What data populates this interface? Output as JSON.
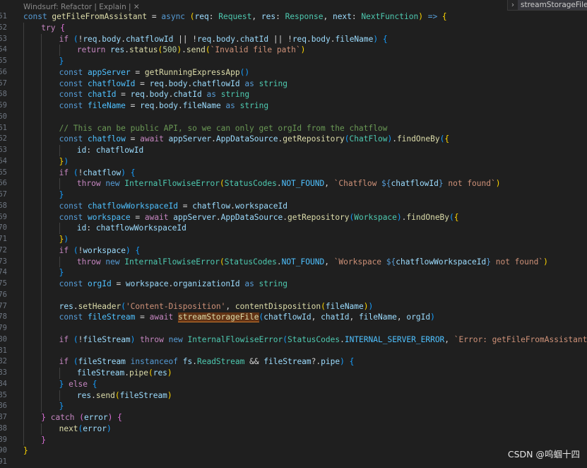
{
  "codelens": "Windsurf: Refactor | Explain | ✕",
  "sticky_scroll": {
    "chevron": "›",
    "label": "streamStorageFile"
  },
  "watermark": "CSDN @呜蝈十四",
  "code_lines": [
    {
      "n": "51",
      "ind": 0,
      "tokens": [
        [
          "k",
          "const "
        ],
        [
          "f",
          "getFileFromAssistant"
        ],
        [
          "p",
          " = "
        ],
        [
          "k",
          "async "
        ],
        [
          "b1",
          "("
        ],
        [
          "v",
          "req"
        ],
        [
          "p",
          ": "
        ],
        [
          "t",
          "Request"
        ],
        [
          "p",
          ", "
        ],
        [
          "v",
          "res"
        ],
        [
          "p",
          ": "
        ],
        [
          "t",
          "Response"
        ],
        [
          "p",
          ", "
        ],
        [
          "v",
          "next"
        ],
        [
          "p",
          ": "
        ],
        [
          "t",
          "NextFunction"
        ],
        [
          "b1",
          ")"
        ],
        [
          "k",
          " => "
        ],
        [
          "b1",
          "{"
        ]
      ]
    },
    {
      "n": "52",
      "ind": 1,
      "tokens": [
        [
          "kc",
          "try "
        ],
        [
          "b2",
          "{"
        ]
      ]
    },
    {
      "n": "53",
      "ind": 2,
      "tokens": [
        [
          "kc",
          "if "
        ],
        [
          "b3",
          "("
        ],
        [
          "p",
          "!"
        ],
        [
          "v",
          "req"
        ],
        [
          "p",
          "."
        ],
        [
          "v",
          "body"
        ],
        [
          "p",
          "."
        ],
        [
          "v",
          "chatflowId"
        ],
        [
          "p",
          " || !"
        ],
        [
          "v",
          "req"
        ],
        [
          "p",
          "."
        ],
        [
          "v",
          "body"
        ],
        [
          "p",
          "."
        ],
        [
          "v",
          "chatId"
        ],
        [
          "p",
          " || !"
        ],
        [
          "v",
          "req"
        ],
        [
          "p",
          "."
        ],
        [
          "v",
          "body"
        ],
        [
          "p",
          "."
        ],
        [
          "v",
          "fileName"
        ],
        [
          "b3",
          ")"
        ],
        [
          "p",
          " "
        ],
        [
          "b3",
          "{"
        ]
      ]
    },
    {
      "n": "54",
      "ind": 3,
      "tokens": [
        [
          "kc",
          "return "
        ],
        [
          "v",
          "res"
        ],
        [
          "p",
          "."
        ],
        [
          "f",
          "status"
        ],
        [
          "b1",
          "("
        ],
        [
          "n",
          "500"
        ],
        [
          "b1",
          ")"
        ],
        [
          "p",
          "."
        ],
        [
          "f",
          "send"
        ],
        [
          "b1",
          "("
        ],
        [
          "s",
          "`Invalid file path`"
        ],
        [
          "b1",
          ")"
        ]
      ]
    },
    {
      "n": "55",
      "ind": 2,
      "tokens": [
        [
          "b3",
          "}"
        ]
      ]
    },
    {
      "n": "56",
      "ind": 2,
      "tokens": [
        [
          "k",
          "const "
        ],
        [
          "cn",
          "appServer"
        ],
        [
          "p",
          " = "
        ],
        [
          "f",
          "getRunningExpressApp"
        ],
        [
          "b3",
          "()"
        ]
      ]
    },
    {
      "n": "57",
      "ind": 2,
      "tokens": [
        [
          "k",
          "const "
        ],
        [
          "cn",
          "chatflowId"
        ],
        [
          "p",
          " = "
        ],
        [
          "v",
          "req"
        ],
        [
          "p",
          "."
        ],
        [
          "v",
          "body"
        ],
        [
          "p",
          "."
        ],
        [
          "v",
          "chatflowId"
        ],
        [
          "k",
          " as "
        ],
        [
          "t",
          "string"
        ]
      ]
    },
    {
      "n": "58",
      "ind": 2,
      "tokens": [
        [
          "k",
          "const "
        ],
        [
          "cn",
          "chatId"
        ],
        [
          "p",
          " = "
        ],
        [
          "v",
          "req"
        ],
        [
          "p",
          "."
        ],
        [
          "v",
          "body"
        ],
        [
          "p",
          "."
        ],
        [
          "v",
          "chatId"
        ],
        [
          "k",
          " as "
        ],
        [
          "t",
          "string"
        ]
      ]
    },
    {
      "n": "59",
      "ind": 2,
      "tokens": [
        [
          "k",
          "const "
        ],
        [
          "cn",
          "fileName"
        ],
        [
          "p",
          " = "
        ],
        [
          "v",
          "req"
        ],
        [
          "p",
          "."
        ],
        [
          "v",
          "body"
        ],
        [
          "p",
          "."
        ],
        [
          "v",
          "fileName"
        ],
        [
          "k",
          " as "
        ],
        [
          "t",
          "string"
        ]
      ]
    },
    {
      "n": "60",
      "ind": 2,
      "tokens": []
    },
    {
      "n": "61",
      "ind": 2,
      "tokens": [
        [
          "c",
          "// This can be public API, so we can only get orgId from the chatflow"
        ]
      ]
    },
    {
      "n": "62",
      "ind": 2,
      "tokens": [
        [
          "k",
          "const "
        ],
        [
          "cn",
          "chatflow"
        ],
        [
          "p",
          " = "
        ],
        [
          "kc",
          "await "
        ],
        [
          "v",
          "appServer"
        ],
        [
          "p",
          "."
        ],
        [
          "v",
          "AppDataSource"
        ],
        [
          "p",
          "."
        ],
        [
          "f",
          "getRepository"
        ],
        [
          "b3",
          "("
        ],
        [
          "t",
          "ChatFlow"
        ],
        [
          "b3",
          ")"
        ],
        [
          "p",
          "."
        ],
        [
          "f",
          "findOneBy"
        ],
        [
          "b3",
          "("
        ],
        [
          "b1",
          "{"
        ]
      ]
    },
    {
      "n": "63",
      "ind": 3,
      "tokens": [
        [
          "v",
          "id"
        ],
        [
          "p",
          ": "
        ],
        [
          "v",
          "chatflowId"
        ]
      ]
    },
    {
      "n": "64",
      "ind": 2,
      "tokens": [
        [
          "b1",
          "}"
        ],
        [
          "b3",
          ")"
        ]
      ]
    },
    {
      "n": "65",
      "ind": 2,
      "tokens": [
        [
          "kc",
          "if "
        ],
        [
          "b3",
          "("
        ],
        [
          "p",
          "!"
        ],
        [
          "v",
          "chatflow"
        ],
        [
          "b3",
          ")"
        ],
        [
          "p",
          " "
        ],
        [
          "b3",
          "{"
        ]
      ]
    },
    {
      "n": "66",
      "ind": 3,
      "tokens": [
        [
          "kc",
          "throw "
        ],
        [
          "k",
          "new "
        ],
        [
          "t",
          "InternalFlowiseError"
        ],
        [
          "b1",
          "("
        ],
        [
          "t",
          "StatusCodes"
        ],
        [
          "p",
          "."
        ],
        [
          "cn",
          "NOT_FOUND"
        ],
        [
          "p",
          ", "
        ],
        [
          "s",
          "`Chatflow "
        ],
        [
          "k",
          "${"
        ],
        [
          "v",
          "chatflowId"
        ],
        [
          "k",
          "}"
        ],
        [
          "s",
          " not found`"
        ],
        [
          "b1",
          ")"
        ]
      ]
    },
    {
      "n": "67",
      "ind": 2,
      "tokens": [
        [
          "b3",
          "}"
        ]
      ]
    },
    {
      "n": "68",
      "ind": 2,
      "tokens": [
        [
          "k",
          "const "
        ],
        [
          "cn",
          "chatflowWorkspaceId"
        ],
        [
          "p",
          " = "
        ],
        [
          "v",
          "chatflow"
        ],
        [
          "p",
          "."
        ],
        [
          "v",
          "workspaceId"
        ]
      ]
    },
    {
      "n": "69",
      "ind": 2,
      "tokens": [
        [
          "k",
          "const "
        ],
        [
          "cn",
          "workspace"
        ],
        [
          "p",
          " = "
        ],
        [
          "kc",
          "await "
        ],
        [
          "v",
          "appServer"
        ],
        [
          "p",
          "."
        ],
        [
          "v",
          "AppDataSource"
        ],
        [
          "p",
          "."
        ],
        [
          "f",
          "getRepository"
        ],
        [
          "b3",
          "("
        ],
        [
          "t",
          "Workspace"
        ],
        [
          "b3",
          ")"
        ],
        [
          "p",
          "."
        ],
        [
          "f",
          "findOneBy"
        ],
        [
          "b3",
          "("
        ],
        [
          "b1",
          "{"
        ]
      ]
    },
    {
      "n": "70",
      "ind": 3,
      "tokens": [
        [
          "v",
          "id"
        ],
        [
          "p",
          ": "
        ],
        [
          "v",
          "chatflowWorkspaceId"
        ]
      ]
    },
    {
      "n": "71",
      "ind": 2,
      "tokens": [
        [
          "b1",
          "}"
        ],
        [
          "b3",
          ")"
        ]
      ]
    },
    {
      "n": "72",
      "ind": 2,
      "tokens": [
        [
          "kc",
          "if "
        ],
        [
          "b3",
          "("
        ],
        [
          "p",
          "!"
        ],
        [
          "v",
          "workspace"
        ],
        [
          "b3",
          ")"
        ],
        [
          "p",
          " "
        ],
        [
          "b3",
          "{"
        ]
      ]
    },
    {
      "n": "73",
      "ind": 3,
      "tokens": [
        [
          "kc",
          "throw "
        ],
        [
          "k",
          "new "
        ],
        [
          "t",
          "InternalFlowiseError"
        ],
        [
          "b1",
          "("
        ],
        [
          "t",
          "StatusCodes"
        ],
        [
          "p",
          "."
        ],
        [
          "cn",
          "NOT_FOUND"
        ],
        [
          "p",
          ", "
        ],
        [
          "s",
          "`Workspace "
        ],
        [
          "k",
          "${"
        ],
        [
          "v",
          "chatflowWorkspaceId"
        ],
        [
          "k",
          "}"
        ],
        [
          "s",
          " not found`"
        ],
        [
          "b1",
          ")"
        ]
      ]
    },
    {
      "n": "74",
      "ind": 2,
      "tokens": [
        [
          "b3",
          "}"
        ]
      ]
    },
    {
      "n": "75",
      "ind": 2,
      "tokens": [
        [
          "k",
          "const "
        ],
        [
          "cn",
          "orgId"
        ],
        [
          "p",
          " = "
        ],
        [
          "v",
          "workspace"
        ],
        [
          "p",
          "."
        ],
        [
          "v",
          "organizationId"
        ],
        [
          "k",
          " as "
        ],
        [
          "t",
          "string"
        ]
      ]
    },
    {
      "n": "76",
      "ind": 2,
      "tokens": []
    },
    {
      "n": "77",
      "ind": 2,
      "tokens": [
        [
          "v",
          "res"
        ],
        [
          "p",
          "."
        ],
        [
          "f",
          "setHeader"
        ],
        [
          "b3",
          "("
        ],
        [
          "s",
          "'Content-Disposition'"
        ],
        [
          "p",
          ", "
        ],
        [
          "f",
          "contentDisposition"
        ],
        [
          "b1",
          "("
        ],
        [
          "v",
          "fileName"
        ],
        [
          "b1",
          ")"
        ],
        [
          "b3",
          ")"
        ]
      ]
    },
    {
      "n": "78",
      "ind": 2,
      "tokens": [
        [
          "k",
          "const "
        ],
        [
          "cn",
          "fileStream"
        ],
        [
          "p",
          " = "
        ],
        [
          "kc",
          "await "
        ],
        [
          "f hl",
          "streamStorageFile"
        ],
        [
          "b3",
          "("
        ],
        [
          "v",
          "chatflowId"
        ],
        [
          "p",
          ", "
        ],
        [
          "v",
          "chatId"
        ],
        [
          "p",
          ", "
        ],
        [
          "v",
          "fileName"
        ],
        [
          "p",
          ", "
        ],
        [
          "v",
          "orgId"
        ],
        [
          "b3",
          ")"
        ]
      ]
    },
    {
      "n": "79",
      "ind": 2,
      "tokens": []
    },
    {
      "n": "80",
      "ind": 2,
      "tokens": [
        [
          "kc",
          "if "
        ],
        [
          "b3",
          "("
        ],
        [
          "p",
          "!"
        ],
        [
          "v",
          "fileStream"
        ],
        [
          "b3",
          ")"
        ],
        [
          "kc",
          " throw "
        ],
        [
          "k",
          "new "
        ],
        [
          "t",
          "InternalFlowiseError"
        ],
        [
          "b3",
          "("
        ],
        [
          "t",
          "StatusCodes"
        ],
        [
          "p",
          "."
        ],
        [
          "cn",
          "INTERNAL_SERVER_ERROR"
        ],
        [
          "p",
          ", "
        ],
        [
          "s",
          "`Error: getFileFromAssistant`"
        ],
        [
          "b3",
          ")"
        ]
      ]
    },
    {
      "n": "81",
      "ind": 2,
      "tokens": []
    },
    {
      "n": "82",
      "ind": 2,
      "tokens": [
        [
          "kc",
          "if "
        ],
        [
          "b3",
          "("
        ],
        [
          "v",
          "fileStream"
        ],
        [
          "k",
          " instanceof "
        ],
        [
          "v",
          "fs"
        ],
        [
          "p",
          "."
        ],
        [
          "t",
          "ReadStream"
        ],
        [
          "p",
          " && "
        ],
        [
          "v",
          "fileStream"
        ],
        [
          "p",
          "?."
        ],
        [
          "v",
          "pipe"
        ],
        [
          "b3",
          ")"
        ],
        [
          "p",
          " "
        ],
        [
          "b3",
          "{"
        ]
      ]
    },
    {
      "n": "83",
      "ind": 3,
      "tokens": [
        [
          "v",
          "fileStream"
        ],
        [
          "p",
          "."
        ],
        [
          "f",
          "pipe"
        ],
        [
          "b1",
          "("
        ],
        [
          "v",
          "res"
        ],
        [
          "b1",
          ")"
        ]
      ]
    },
    {
      "n": "84",
      "ind": 2,
      "tokens": [
        [
          "b3",
          "}"
        ],
        [
          "kc",
          " else "
        ],
        [
          "b3",
          "{"
        ]
      ]
    },
    {
      "n": "85",
      "ind": 3,
      "tokens": [
        [
          "v",
          "res"
        ],
        [
          "p",
          "."
        ],
        [
          "f",
          "send"
        ],
        [
          "b1",
          "("
        ],
        [
          "v",
          "fileStream"
        ],
        [
          "b1",
          ")"
        ]
      ]
    },
    {
      "n": "86",
      "ind": 2,
      "tokens": [
        [
          "b3",
          "}"
        ]
      ]
    },
    {
      "n": "87",
      "ind": 1,
      "tokens": [
        [
          "b2",
          "}"
        ],
        [
          "kc",
          " catch "
        ],
        [
          "b2",
          "("
        ],
        [
          "v",
          "error"
        ],
        [
          "b2",
          ")"
        ],
        [
          "p",
          " "
        ],
        [
          "b2",
          "{"
        ]
      ]
    },
    {
      "n": "88",
      "ind": 2,
      "tokens": [
        [
          "f",
          "next"
        ],
        [
          "b3",
          "("
        ],
        [
          "v",
          "error"
        ],
        [
          "b3",
          ")"
        ]
      ]
    },
    {
      "n": "89",
      "ind": 1,
      "tokens": [
        [
          "b2",
          "}"
        ]
      ]
    },
    {
      "n": "90",
      "ind": 0,
      "tokens": [
        [
          "b1",
          "}"
        ]
      ]
    },
    {
      "n": "91",
      "ind": 0,
      "tokens": []
    }
  ]
}
